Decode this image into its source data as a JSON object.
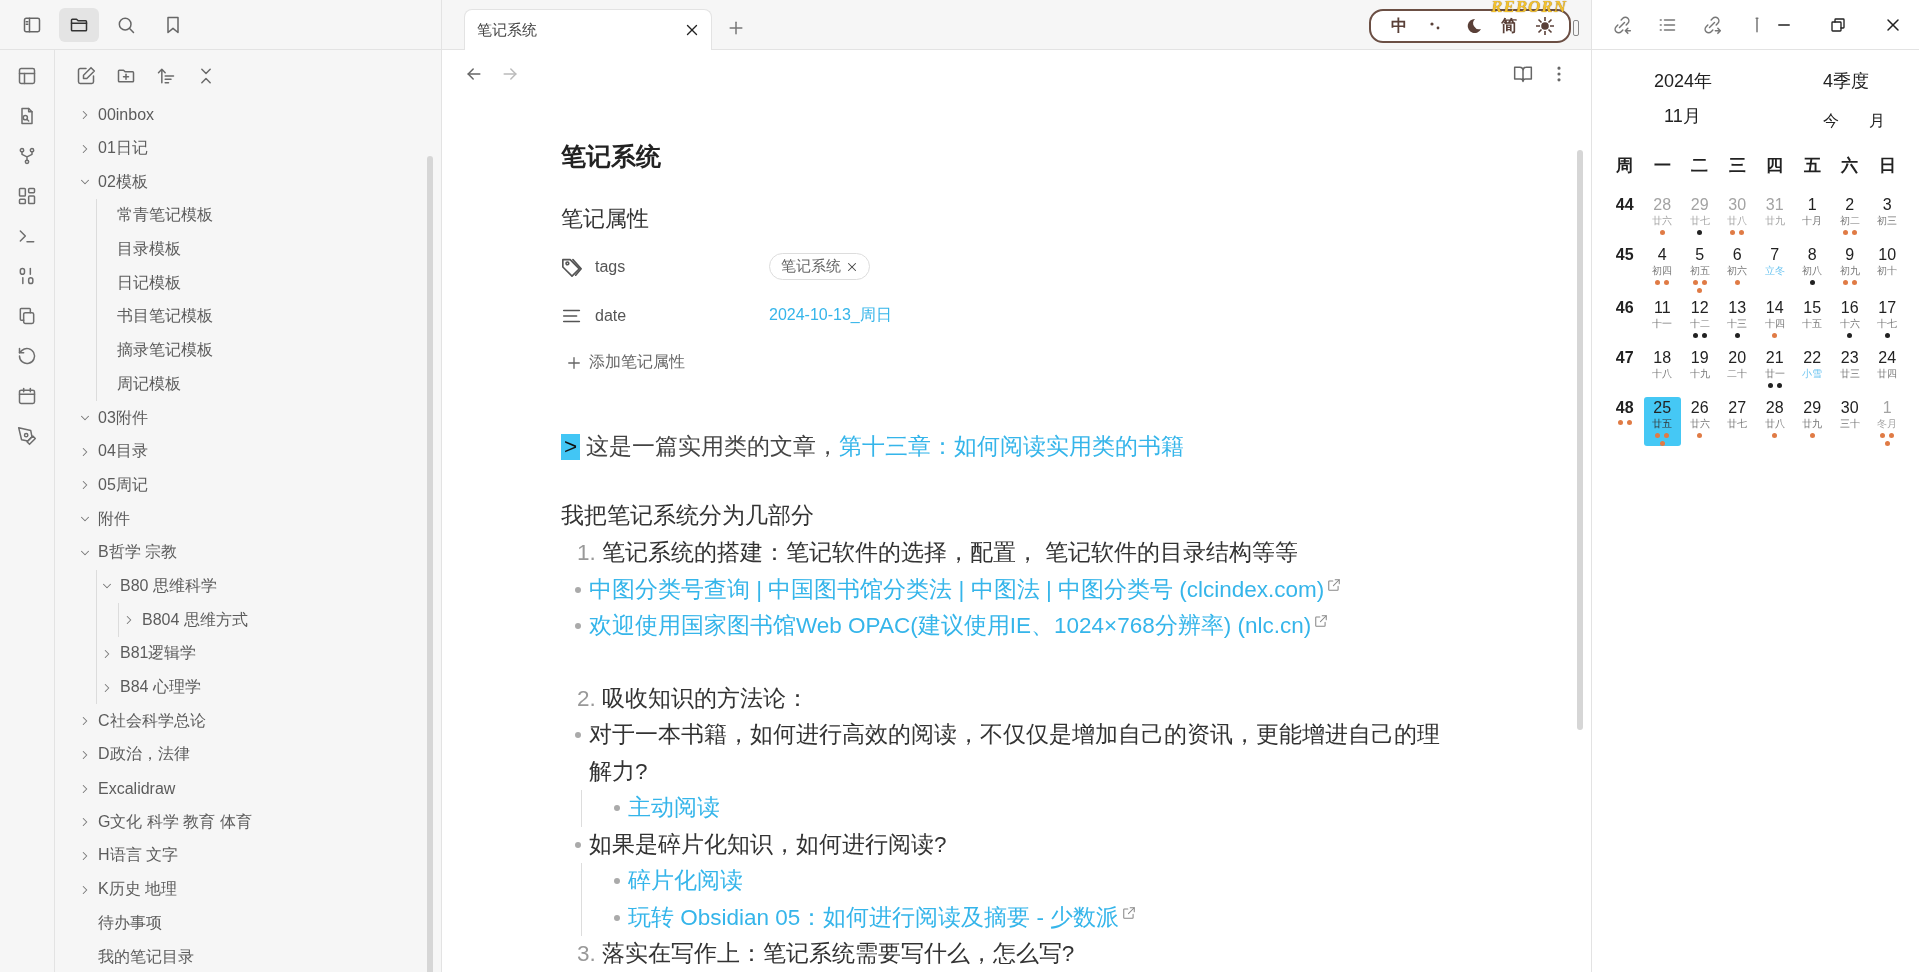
{
  "left_toolbar": [
    {
      "kind": "sidebar",
      "selected": false
    },
    {
      "kind": "folder",
      "selected": true
    },
    {
      "kind": "search",
      "selected": false
    },
    {
      "kind": "bookmark",
      "selected": false
    }
  ],
  "ribbon": [
    {
      "kind": "layout"
    },
    {
      "kind": "file-search"
    },
    {
      "kind": "graph"
    },
    {
      "kind": "grid"
    },
    {
      "kind": "terminal"
    },
    {
      "kind": "binary"
    },
    {
      "kind": "copy"
    },
    {
      "kind": "history"
    },
    {
      "kind": "calendar"
    },
    {
      "kind": "pen"
    }
  ],
  "file_toolbar": [
    {
      "kind": "new-note"
    },
    {
      "kind": "new-folder"
    },
    {
      "kind": "sort"
    },
    {
      "kind": "collapse"
    }
  ],
  "file_tree": [
    {
      "kind": "folder",
      "label": "00inbox",
      "expanded": false
    },
    {
      "kind": "folder",
      "label": "01日记",
      "expanded": false
    },
    {
      "kind": "folder",
      "label": "02模板",
      "expanded": true,
      "children": [
        {
          "kind": "file",
          "label": "常青笔记模板"
        },
        {
          "kind": "file",
          "label": "目录模板"
        },
        {
          "kind": "file",
          "label": "日记模板"
        },
        {
          "kind": "file",
          "label": "书目笔记模板"
        },
        {
          "kind": "file",
          "label": "摘录笔记模板"
        },
        {
          "kind": "file",
          "label": "周记模板"
        }
      ]
    },
    {
      "kind": "folder",
      "label": "03附件",
      "expanded": true
    },
    {
      "kind": "folder",
      "label": "04目录",
      "expanded": false
    },
    {
      "kind": "folder",
      "label": "05周记",
      "expanded": false
    },
    {
      "kind": "folder",
      "label": "附件",
      "expanded": true
    },
    {
      "kind": "folder",
      "label": "B哲学 宗教",
      "expanded": true,
      "children": [
        {
          "kind": "folder",
          "label": "B80 思维科学",
          "expanded": true,
          "children": [
            {
              "kind": "folder",
              "label": "B804 思维方式",
              "expanded": false
            }
          ]
        },
        {
          "kind": "folder",
          "label": "B81逻辑学",
          "expanded": false
        },
        {
          "kind": "folder",
          "label": "B84 心理学",
          "expanded": false
        }
      ]
    },
    {
      "kind": "folder",
      "label": "C社会科学总论",
      "expanded": false
    },
    {
      "kind": "folder",
      "label": "D政治，法律",
      "expanded": false
    },
    {
      "kind": "folder",
      "label": "Excalidraw",
      "expanded": false
    },
    {
      "kind": "folder",
      "label": "G文化 科学 教育 体育",
      "expanded": false
    },
    {
      "kind": "folder",
      "label": "H语言 文字",
      "expanded": false
    },
    {
      "kind": "folder",
      "label": "K历史 地理",
      "expanded": false
    },
    {
      "kind": "file",
      "label": "待办事项"
    },
    {
      "kind": "file",
      "label": "我的笔记目录"
    }
  ],
  "tabs": [
    {
      "label": "笔记系统",
      "selected": true
    }
  ],
  "theme_widget": {
    "title": "REBORN",
    "buttons": [
      {
        "kind": "text",
        "label": "中"
      },
      {
        "kind": "dots"
      },
      {
        "kind": "moon"
      },
      {
        "kind": "text",
        "label": "简"
      },
      {
        "kind": "sun"
      }
    ]
  },
  "right_toolbar": [
    {
      "kind": "backlinks"
    },
    {
      "kind": "outline"
    },
    {
      "kind": "outgoing"
    },
    {
      "kind": "pin"
    }
  ],
  "note": {
    "title": "笔记系统",
    "properties": {
      "heading": "笔记属性",
      "items": [
        {
          "kind": "tags",
          "name": "tags",
          "tags": [
            "笔记系统"
          ]
        },
        {
          "kind": "date",
          "name": "date",
          "value": "2024-10-13_周日"
        }
      ],
      "add_label": "添加笔记属性"
    },
    "body": [
      {
        "kind": "quote",
        "marker": ">",
        "text": "这是一篇实用类的文章，",
        "link": "第十三章：如何阅读实用类的书籍"
      },
      {
        "kind": "paragraph",
        "text": "我把笔记系统分为几部分"
      },
      {
        "kind": "numbered",
        "number": "1.",
        "text": "笔记系统的搭建：笔记软件的选择，配置， 笔记软件的目录结构等等"
      },
      {
        "kind": "bullet",
        "text": "中图分类号查询 | 中国图书馆分类法 | 中图法 | 中图分类号 (clcindex.com)",
        "link": true,
        "external": true
      },
      {
        "kind": "bullet",
        "text": "欢迎使用国家图书馆Web OPAC(建议使用IE、1024×768分辨率) (nlc.cn)",
        "link": true,
        "external": true
      },
      {
        "kind": "numbered",
        "number": "2.",
        "text": "吸收知识的方法论："
      },
      {
        "kind": "bullet",
        "text": "对于一本书籍，如何进行高效的阅读，不仅仅是增加自己的资讯，更能增进自己的理解力?",
        "link": false,
        "external": false,
        "children": [
          {
            "kind": "bullet",
            "text": "主动阅读",
            "link": true,
            "external": false
          }
        ]
      },
      {
        "kind": "bullet",
        "text": "如果是碎片化知识，如何进行阅读?",
        "link": false,
        "external": false,
        "children": [
          {
            "kind": "bullet",
            "text": "碎片化阅读",
            "link": true,
            "external": false
          },
          {
            "kind": "bullet",
            "text": "玩转 Obsidian 05：如何进行阅读及摘要 - 少数派",
            "link": true,
            "external": true
          }
        ]
      },
      {
        "kind": "numbered",
        "number": "3.",
        "text": "落实在写作上：笔记系统需要写什么，怎么写?"
      }
    ]
  },
  "calendar": {
    "year": "2024年",
    "quarter": "4季度",
    "month": "11月",
    "today_button": "今",
    "month_button": "月",
    "weekdays": [
      "周",
      "一",
      "二",
      "三",
      "四",
      "五",
      "六",
      "日"
    ],
    "weeks": [
      {
        "number": "44",
        "days": [
          {
            "day": "28",
            "lunar": "廿六",
            "muted": true,
            "solar_term": false,
            "selected": false,
            "dots": [
              {
                "color": "#e07b45"
              }
            ]
          },
          {
            "day": "29",
            "lunar": "廿七",
            "muted": true,
            "solar_term": false,
            "selected": false,
            "dots": [
              {
                "color": "#222222"
              }
            ]
          },
          {
            "day": "30",
            "lunar": "廿八",
            "muted": true,
            "solar_term": false,
            "selected": false,
            "dots": [
              {
                "color": "#e07b45"
              },
              {
                "color": "#e07b45"
              }
            ]
          },
          {
            "day": "31",
            "lunar": "廿九",
            "muted": true,
            "solar_term": false,
            "selected": false
          },
          {
            "day": "1",
            "lunar": "十月",
            "muted": false,
            "solar_term": false,
            "selected": false
          },
          {
            "day": "2",
            "lunar": "初二",
            "muted": false,
            "solar_term": false,
            "selected": false,
            "dots": [
              {
                "color": "#e07b45"
              },
              {
                "color": "#e07b45"
              }
            ]
          },
          {
            "day": "3",
            "lunar": "初三",
            "muted": false,
            "solar_term": false,
            "selected": false
          }
        ]
      },
      {
        "number": "45",
        "days": [
          {
            "day": "4",
            "lunar": "初四",
            "muted": false,
            "solar_term": false,
            "selected": false,
            "dots": [
              {
                "color": "#e07b45"
              },
              {
                "color": "#e07b45"
              }
            ]
          },
          {
            "day": "5",
            "lunar": "初五",
            "muted": false,
            "solar_term": false,
            "selected": false,
            "dots": [
              {
                "color": "#e07b45"
              },
              {
                "color": "#e07b45"
              },
              {
                "color": "#e07b45"
              }
            ]
          },
          {
            "day": "6",
            "lunar": "初六",
            "muted": false,
            "solar_term": false,
            "selected": false,
            "dots": [
              {
                "color": "#e07b45"
              }
            ]
          },
          {
            "day": "7",
            "lunar": "立冬",
            "muted": false,
            "solar_term": true,
            "selected": false
          },
          {
            "day": "8",
            "lunar": "初八",
            "muted": false,
            "solar_term": false,
            "selected": false,
            "dots": [
              {
                "color": "#222222"
              }
            ]
          },
          {
            "day": "9",
            "lunar": "初九",
            "muted": false,
            "solar_term": false,
            "selected": false,
            "dots": [
              {
                "color": "#e07b45"
              },
              {
                "color": "#e07b45"
              }
            ]
          },
          {
            "day": "10",
            "lunar": "初十",
            "muted": false,
            "solar_term": false,
            "selected": false
          }
        ]
      },
      {
        "number": "46",
        "days": [
          {
            "day": "11",
            "lunar": "十一",
            "muted": false,
            "solar_term": false,
            "selected": false
          },
          {
            "day": "12",
            "lunar": "十二",
            "muted": false,
            "solar_term": false,
            "selected": false,
            "dots": [
              {
                "color": "#222222"
              },
              {
                "color": "#222222"
              }
            ]
          },
          {
            "day": "13",
            "lunar": "十三",
            "muted": false,
            "solar_term": false,
            "selected": false,
            "dots": [
              {
                "color": "#222222"
              }
            ]
          },
          {
            "day": "14",
            "lunar": "十四",
            "muted": false,
            "solar_term": false,
            "selected": false,
            "dots": [
              {
                "color": "#e07b45"
              }
            ]
          },
          {
            "day": "15",
            "lunar": "十五",
            "muted": false,
            "solar_term": false,
            "selected": false
          },
          {
            "day": "16",
            "lunar": "十六",
            "muted": false,
            "solar_term": false,
            "selected": false,
            "dots": [
              {
                "color": "#222222"
              }
            ]
          },
          {
            "day": "17",
            "lunar": "十七",
            "muted": false,
            "solar_term": false,
            "selected": false,
            "dots": [
              {
                "color": "#222222"
              }
            ]
          }
        ]
      },
      {
        "number": "47",
        "days": [
          {
            "day": "18",
            "lunar": "十八",
            "muted": false,
            "solar_term": false,
            "selected": false
          },
          {
            "day": "19",
            "lunar": "十九",
            "muted": false,
            "solar_term": false,
            "selected": false
          },
          {
            "day": "20",
            "lunar": "二十",
            "muted": false,
            "solar_term": false,
            "selected": false
          },
          {
            "day": "21",
            "lunar": "廿一",
            "muted": false,
            "solar_term": false,
            "selected": false,
            "dots": [
              {
                "color": "#222222"
              },
              {
                "color": "#222222"
              }
            ]
          },
          {
            "day": "22",
            "lunar": "小雪",
            "muted": false,
            "solar_term": true,
            "selected": false
          },
          {
            "day": "23",
            "lunar": "廿三",
            "muted": false,
            "solar_term": false,
            "selected": false
          },
          {
            "day": "24",
            "lunar": "廿四",
            "muted": false,
            "solar_term": false,
            "selected": false
          }
        ]
      },
      {
        "number": "48",
        "dots": [
          {
            "color": "#e07b45"
          },
          {
            "color": "#e07b45"
          }
        ],
        "days": [
          {
            "day": "25",
            "lunar": "廿五",
            "muted": false,
            "solar_term": false,
            "selected": true,
            "dots": [
              {
                "color": "#e07b45"
              },
              {
                "color": "#e07b45"
              },
              {
                "color": "#e07b45"
              }
            ]
          },
          {
            "day": "26",
            "lunar": "廿六",
            "muted": false,
            "solar_term": false,
            "selected": false,
            "dots": [
              {
                "color": "#e07b45"
              }
            ]
          },
          {
            "day": "27",
            "lunar": "廿七",
            "muted": false,
            "solar_term": false,
            "selected": false
          },
          {
            "day": "28",
            "lunar": "廿八",
            "muted": false,
            "solar_term": false,
            "selected": false,
            "dots": [
              {
                "color": "#e07b45"
              }
            ]
          },
          {
            "day": "29",
            "lunar": "廿九",
            "muted": false,
            "solar_term": false,
            "selected": false,
            "dots": [
              {
                "color": "#e07b45"
              }
            ]
          },
          {
            "day": "30",
            "lunar": "三十",
            "muted": false,
            "solar_term": false,
            "selected": false
          },
          {
            "day": "1",
            "lunar": "冬月",
            "muted": true,
            "solar_term": false,
            "selected": false,
            "dots": [
              {
                "color": "#e07b45"
              },
              {
                "color": "#e07b45"
              },
              {
                "color": "#e07b45"
              }
            ]
          }
        ]
      }
    ]
  }
}
